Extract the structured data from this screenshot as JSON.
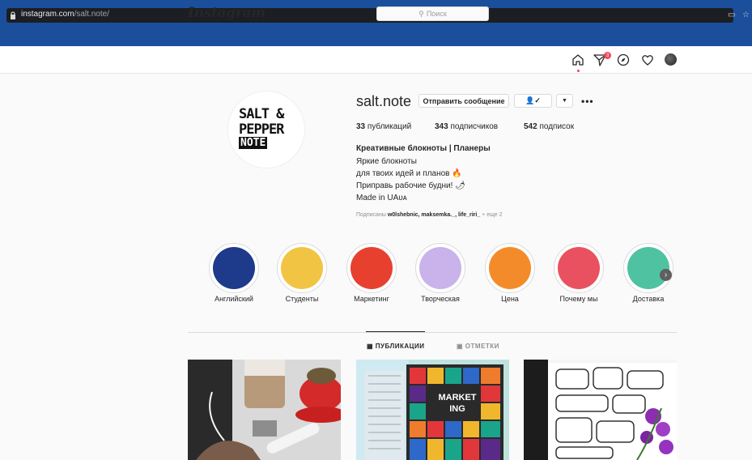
{
  "browser": {
    "url_host": "instagram.com",
    "url_path": "/salt.note/"
  },
  "header": {
    "logo": "Instagram",
    "search_placeholder": "Поиск",
    "notification_count": "3"
  },
  "profile": {
    "username": "salt.note",
    "message_button": "Отправить сообщение",
    "logo_lines": [
      "SALT &",
      "PEPPER",
      "NOTE"
    ],
    "stats": {
      "posts_value": "33",
      "posts_label": "публикаций",
      "followers_value": "343",
      "followers_label": "подписчиков",
      "following_value": "542",
      "following_label": "подписок"
    },
    "bio": {
      "title": "Креативные блокноты | Планеры",
      "line1": "Яркие блокноты",
      "line2": "для твоих идей и планов 🔥",
      "line3": "Приправь рабочие будни! 🌶",
      "line4": "Made in UAᴜᴀ"
    },
    "followed_by": {
      "prefix": "Подписаны",
      "names": "w0lshebnic, maksemka._, life_riri_",
      "suffix": "+ еще 2"
    }
  },
  "highlights": [
    {
      "label": "Английский",
      "color": "#1e3a8a",
      "icon": "england-flag-icon"
    },
    {
      "label": "Студенты",
      "color": "#f2c443",
      "icon": "lemon-icon"
    },
    {
      "label": "Маркетинг",
      "color": "#e8402f",
      "icon": "chili-pepper-icon"
    },
    {
      "label": "Творческая",
      "color": "#c9b3ea",
      "icon": "lavender-icon"
    },
    {
      "label": "Цена",
      "color": "#f48b2a",
      "icon": "price-tag-icon"
    },
    {
      "label": "Почему мы",
      "color": "#ea5160",
      "icon": "star-anise-icon"
    },
    {
      "label": "Доставка",
      "color": "#4fc2a2",
      "icon": "garlic-icon"
    }
  ],
  "tabs": {
    "posts": "ПУБЛИКАЦИИ",
    "tagged": "ОТМЕТКИ"
  },
  "posts": [
    {
      "icon": "coffee-desk-photo"
    },
    {
      "overlay": "MARKET\nING",
      "icon": "marketing-notebook-photo"
    },
    {
      "icon": "doodle-notebook-photo"
    }
  ]
}
